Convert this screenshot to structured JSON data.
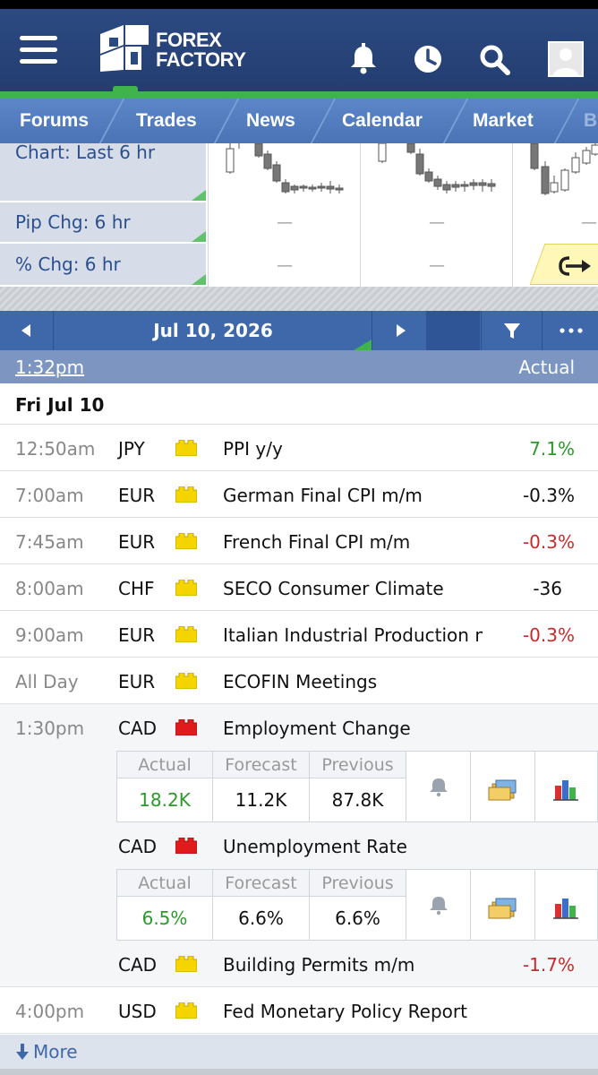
{
  "header": {
    "logo_line1": "FOREX",
    "logo_line2": "FACTORY"
  },
  "nav": {
    "items": [
      "Forums",
      "Trades",
      "News",
      "Calendar",
      "Market",
      "B"
    ]
  },
  "market": {
    "chart_label": "Chart: Last 6 hr",
    "pip_label": "Pip Chg: 6 hr",
    "pct_label": "% Chg: 6 hr",
    "dash": "—"
  },
  "calendar": {
    "date": "Jul 10, 2026",
    "time_link": "1:32pm",
    "actual_header": "Actual",
    "day_header": "Fri Jul 10",
    "events": [
      {
        "time": "12:50am",
        "currency": "JPY",
        "impact": "yellow",
        "event": "PPI y/y",
        "actual": "7.1%",
        "actual_color": "green"
      },
      {
        "time": "7:00am",
        "currency": "EUR",
        "impact": "yellow",
        "event": "German Final CPI m/m",
        "actual": "-0.3%",
        "actual_color": "black"
      },
      {
        "time": "7:45am",
        "currency": "EUR",
        "impact": "yellow",
        "event": "French Final CPI m/m",
        "actual": "-0.3%",
        "actual_color": "red"
      },
      {
        "time": "8:00am",
        "currency": "CHF",
        "impact": "yellow",
        "event": "SECO Consumer Climate",
        "actual": "-36",
        "actual_color": "black"
      },
      {
        "time": "9:00am",
        "currency": "EUR",
        "impact": "yellow",
        "event": "Italian Industrial Production m/m",
        "actual": "-0.3%",
        "actual_color": "red"
      },
      {
        "time": "All Day",
        "currency": "EUR",
        "impact": "yellow",
        "event": "ECOFIN Meetings",
        "actual": "",
        "actual_color": "black"
      },
      {
        "time": "1:30pm",
        "currency": "CAD",
        "impact": "red",
        "event": "Employment Change",
        "actual": "",
        "actual_color": "black",
        "detail": {
          "actual_label": "Actual",
          "forecast_label": "Forecast",
          "previous_label": "Previous",
          "actual": "18.2K",
          "forecast": "11.2K",
          "previous": "87.8K"
        }
      },
      {
        "time": "",
        "currency": "CAD",
        "impact": "red",
        "event": "Unemployment Rate",
        "actual": "",
        "actual_color": "black",
        "detail": {
          "actual_label": "Actual",
          "forecast_label": "Forecast",
          "previous_label": "Previous",
          "actual": "6.5%",
          "forecast": "6.6%",
          "previous": "6.6%"
        }
      },
      {
        "time": "",
        "currency": "CAD",
        "impact": "yellow",
        "event": "Building Permits m/m",
        "actual": "-1.7%",
        "actual_color": "red"
      },
      {
        "time": "4:00pm",
        "currency": "USD",
        "impact": "yellow",
        "event": "Fed Monetary Policy Report",
        "actual": "",
        "actual_color": "black"
      }
    ],
    "more_label": "More"
  },
  "colors": {
    "header_bg": "#2c4a82",
    "nav_bg": "#5c86c8",
    "accent_green": "#3fb44a",
    "impact_yellow": "#f5d400",
    "impact_red": "#e01b1b",
    "value_green": "#2a9a2a",
    "value_red": "#c62b2b"
  },
  "icons": [
    "menu-icon",
    "bell-icon",
    "clock-icon",
    "search-icon",
    "avatar-icon",
    "share-arrow-icon",
    "chevron-left-icon",
    "chevron-right-icon",
    "filter-icon",
    "more-dots-icon",
    "alert-bell-icon",
    "folder-icon",
    "bar-chart-icon",
    "down-arrow-icon"
  ]
}
